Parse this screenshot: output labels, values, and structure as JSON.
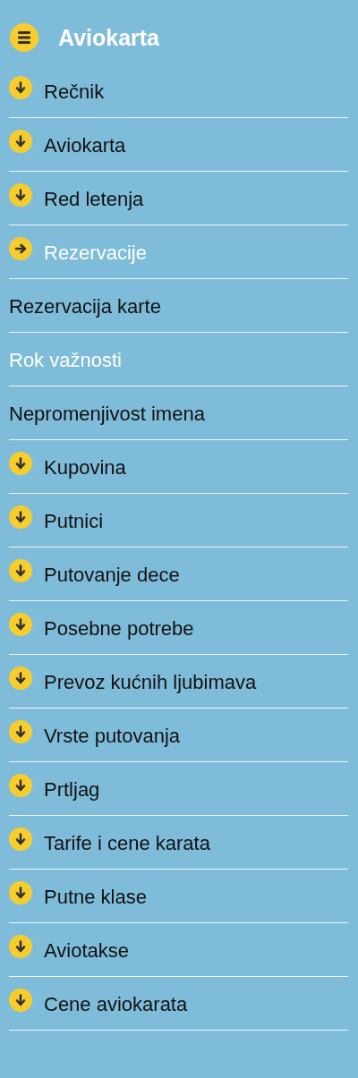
{
  "header": {
    "title": "Aviokarta"
  },
  "menu": [
    {
      "label": "Rečnik",
      "expanded": false
    },
    {
      "label": "Aviokarta",
      "expanded": false
    },
    {
      "label": "Red letenja",
      "expanded": false
    },
    {
      "label": "Rezervacije",
      "expanded": true,
      "children": [
        {
          "label": "Rezervacija karte",
          "selected": false
        },
        {
          "label": "Rok važnosti",
          "selected": true
        },
        {
          "label": "Nepromenjivost imena",
          "selected": false
        }
      ]
    },
    {
      "label": "Kupovina",
      "expanded": false
    },
    {
      "label": "Putnici",
      "expanded": false
    },
    {
      "label": "Putovanje dece",
      "expanded": false
    },
    {
      "label": "Posebne potrebe",
      "expanded": false
    },
    {
      "label": "Prevoz kućnih ljubimava",
      "expanded": false
    },
    {
      "label": "Vrste putovanja",
      "expanded": false
    },
    {
      "label": "Prtljag",
      "expanded": false
    },
    {
      "label": "Tarife i cene karata",
      "expanded": false
    },
    {
      "label": "Putne klase",
      "expanded": false
    },
    {
      "label": "Aviotakse",
      "expanded": false
    },
    {
      "label": "Cene aviokarata",
      "expanded": false
    }
  ]
}
